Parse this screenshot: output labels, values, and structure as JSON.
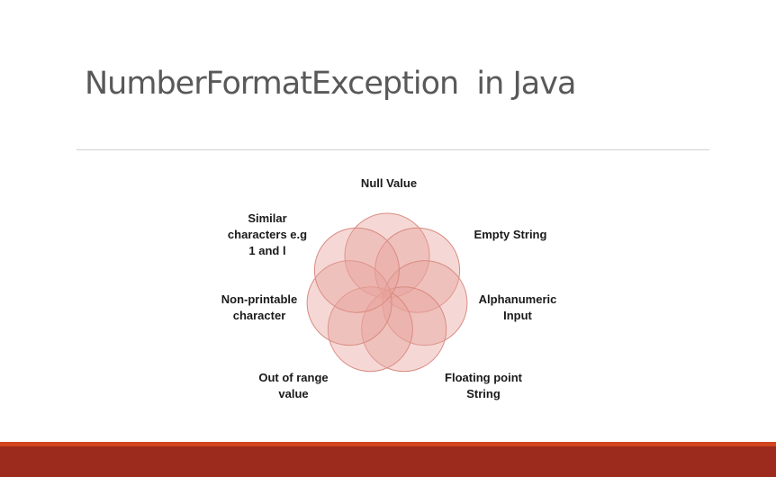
{
  "slide": {
    "title": "NumberFormatException  in Java"
  },
  "diagram": {
    "type": "radial-venn",
    "fill_color": "#e8a29a",
    "stroke_color": "#d98b82",
    "items": [
      {
        "label": "Null Value"
      },
      {
        "label": "Empty String"
      },
      {
        "label": "Alphanumeric\nInput"
      },
      {
        "label": "Floating point\nString"
      },
      {
        "label": "Out of range\nvalue"
      },
      {
        "label": "Non-printable\ncharacter"
      },
      {
        "label": "Similar\ncharacters e.g\n1 and l"
      }
    ]
  },
  "theme": {
    "bar_thin_color": "#d2451e",
    "bar_thick_color": "#9c2a1d"
  }
}
